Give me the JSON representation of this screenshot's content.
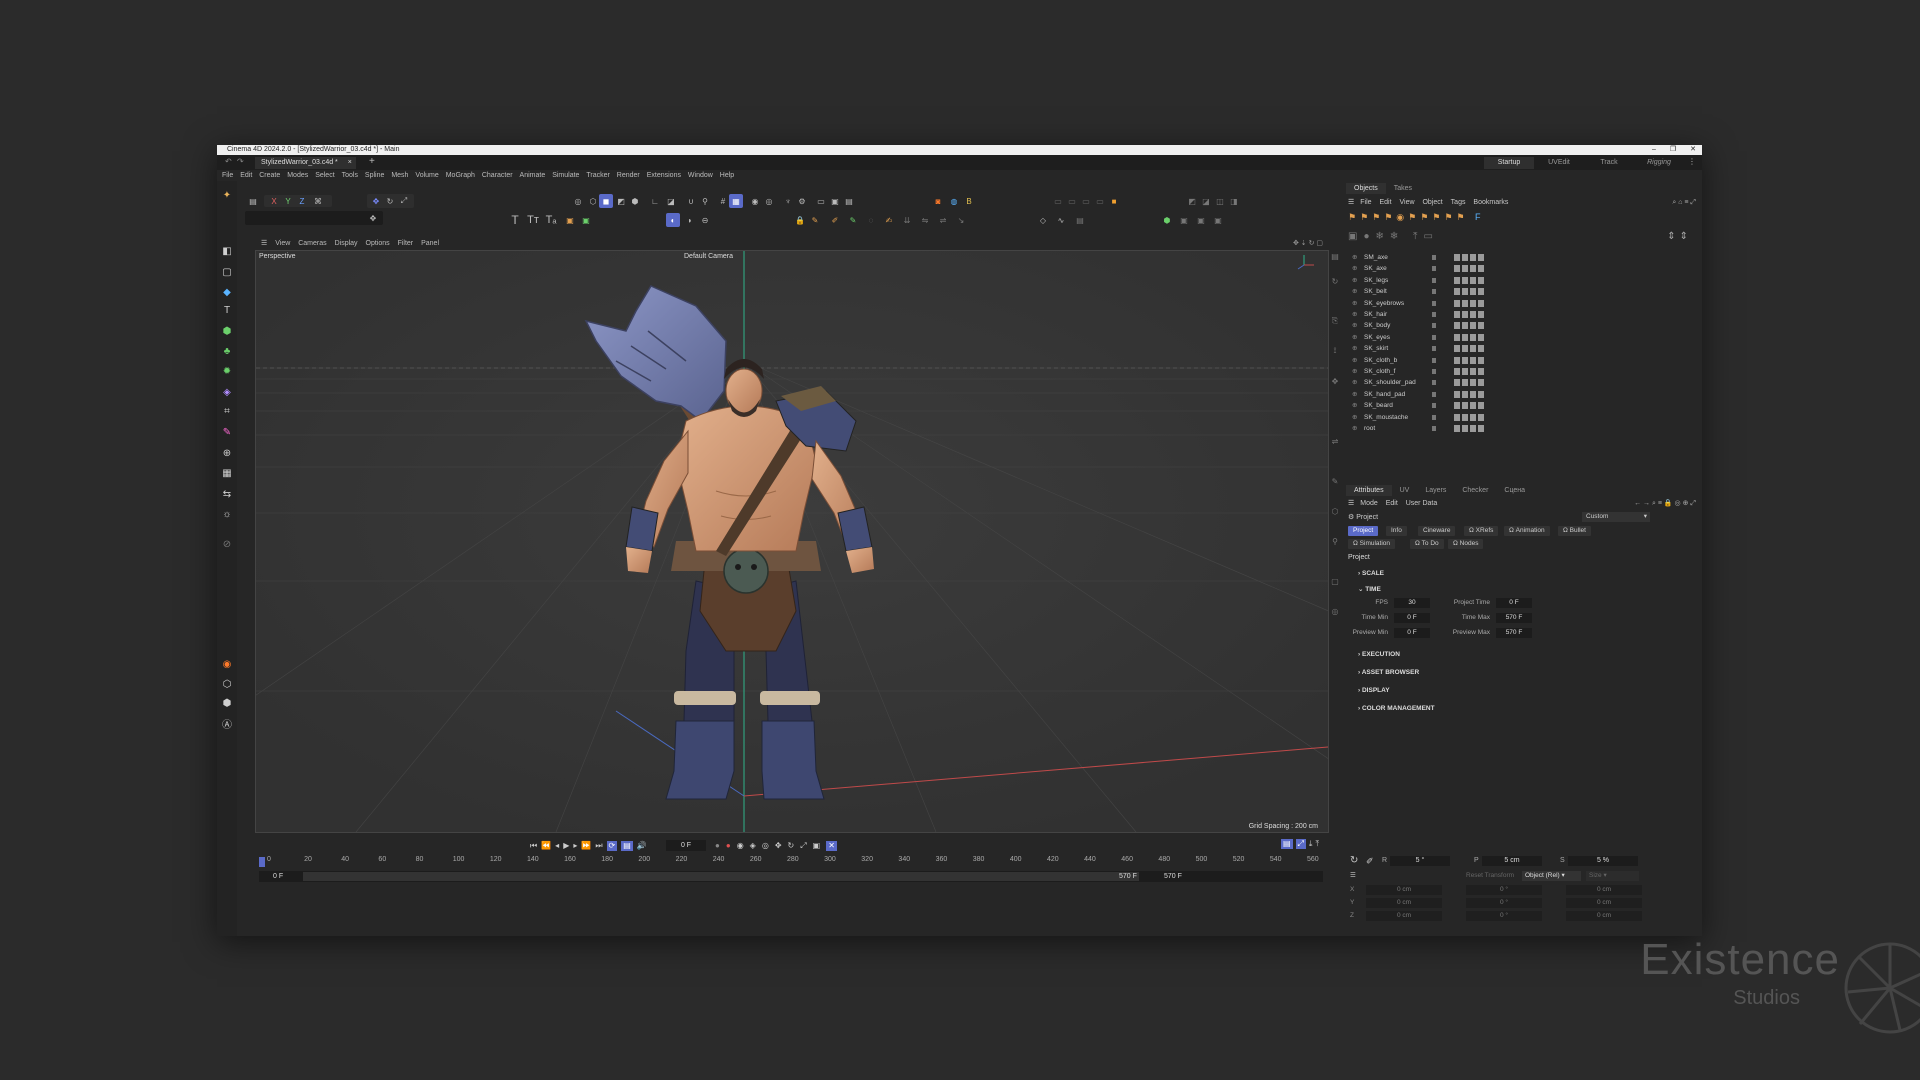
{
  "window": {
    "title": "Cinema 4D 2024.2.0 - [StylizedWarrior_03.c4d *] - Main",
    "controls": [
      "–",
      "❐",
      "✕"
    ]
  },
  "doc_tab": {
    "label": "StylizedWarrior_03.c4d *",
    "close": "×",
    "add": "+"
  },
  "layouts": [
    "Startup",
    "UVEdit",
    "Track",
    "Rigging"
  ],
  "menu": [
    "File",
    "Edit",
    "Create",
    "Modes",
    "Select",
    "Tools",
    "Spline",
    "Mesh",
    "Volume",
    "MoGraph",
    "Character",
    "Animate",
    "Simulate",
    "Tracker",
    "Render",
    "Extensions",
    "Window",
    "Help"
  ],
  "axis_buttons": [
    "X",
    "Y",
    "Z"
  ],
  "viewport": {
    "menu": [
      "View",
      "Cameras",
      "Display",
      "Options",
      "Filter",
      "Panel"
    ],
    "view_name": "Perspective",
    "camera": "Default Camera",
    "grid_spacing": "Grid Spacing : 200 cm"
  },
  "timeline": {
    "current_frame": "0 F",
    "ruler": [
      "0",
      "20",
      "40",
      "60",
      "80",
      "100",
      "120",
      "140",
      "160",
      "180",
      "200",
      "220",
      "240",
      "260",
      "280",
      "300",
      "320",
      "340",
      "360",
      "380",
      "400",
      "420",
      "440",
      "460",
      "480",
      "500",
      "520",
      "540",
      "560"
    ],
    "range_start_a": "0 F",
    "range_start_b": "0 F",
    "range_end_a": "570 F",
    "range_end_b": "570 F"
  },
  "objects_panel": {
    "tabs": [
      "Objects",
      "Takes"
    ],
    "menu": [
      "File",
      "Edit",
      "View",
      "Object",
      "Tags",
      "Bookmarks"
    ],
    "items": [
      "SM_axe",
      "SK_axe",
      "SK_legs",
      "SK_belt",
      "SK_eyebrows",
      "SK_hair",
      "SK_body",
      "SK_eyes",
      "SK_skirt",
      "SK_cloth_b",
      "SK_cloth_f",
      "SK_shoulder_pad",
      "SK_hand_pad",
      "SK_beard",
      "SK_moustache",
      "root"
    ]
  },
  "attributes_panel": {
    "tabs": [
      "Attributes",
      "UV",
      "Layers",
      "Checker",
      "Сцена"
    ],
    "menu": [
      "Mode",
      "Edit",
      "User Data"
    ],
    "object_label": "Project",
    "preset": "Custom",
    "buttons_row1": [
      "Project",
      "Info",
      "Cineware",
      "XRefs",
      "Animation",
      "Bullet"
    ],
    "buttons_row2": [
      "Simulation",
      "To Do",
      "Nodes"
    ],
    "heading": "Project",
    "sections": [
      "SCALE",
      "TIME",
      "EXECUTION",
      "ASSET BROWSER",
      "DISPLAY",
      "COLOR MANAGEMENT"
    ],
    "time": {
      "fps_label": "FPS",
      "fps": "30",
      "project_time_label": "Project Time",
      "project_time": "0 F",
      "time_min_label": "Time Min",
      "time_min": "0 F",
      "time_max_label": "Time Max",
      "time_max": "570 F",
      "preview_min_label": "Preview Min",
      "preview_min": "0 F",
      "preview_max_label": "Preview Max",
      "preview_max": "570 F"
    }
  },
  "coords": {
    "r_label": "R",
    "r": "5 °",
    "p_label": "P",
    "p": "5 cm",
    "s_label": "S",
    "s": "5 %",
    "reset": "Reset Transform",
    "mode": "Object (Rel)",
    "size": "Size",
    "rows": [
      {
        "axis": "X",
        "pos": "0 cm",
        "rot": "0 °",
        "size": "0 cm"
      },
      {
        "axis": "Y",
        "pos": "0 cm",
        "rot": "0 °",
        "size": "0 cm"
      },
      {
        "axis": "Z",
        "pos": "0 cm",
        "rot": "0 °",
        "size": "0 cm"
      }
    ]
  },
  "watermark": {
    "line1": "Existence",
    "line2": "Studios"
  },
  "colors": {
    "accent": "#5a6ac8",
    "viewport_bg": "#353535",
    "panel_bg": "#262626"
  }
}
